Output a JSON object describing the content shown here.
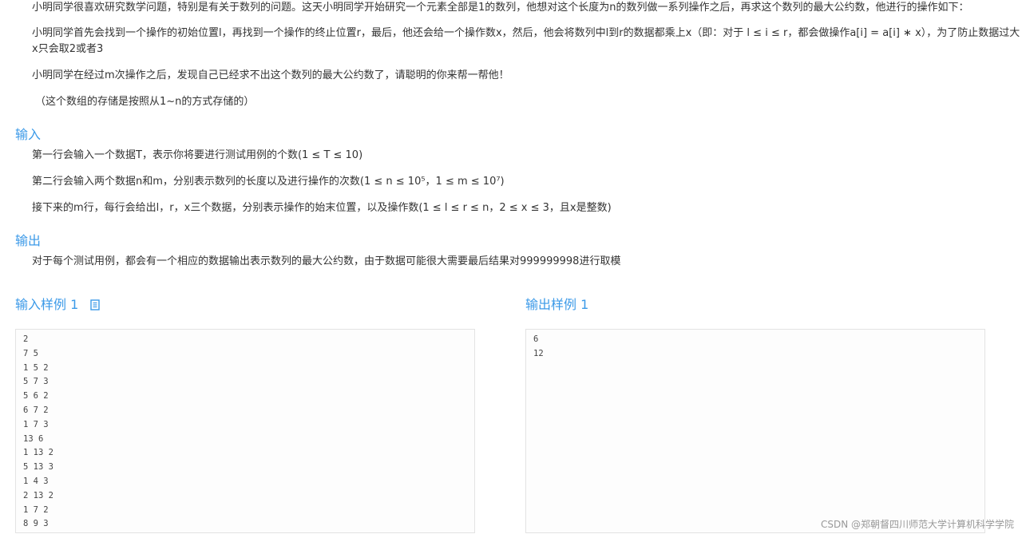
{
  "problem": {
    "p1": "小明同学很喜欢研究数学问题，特别是有关于数列的问题。这天小明同学开始研究一个元素全部是1的数列，他想对这个长度为n的数列做一系列操作之后，再求这个数列的最大公约数，他进行的操作如下：",
    "p2": "小明同学首先会找到一个操作的初始位置l，再找到一个操作的终止位置r，最后，他还会给一个操作数x，然后，他会将数列中l到r的数据都乘上x（即：对于 l ≤ i ≤ r，都会做操作a[i] = a[i] ∗ x），为了防止数据过大x只会取2或者3",
    "p3": "小明同学在经过m次操作之后，发现自己已经求不出这个数列的最大公约数了，请聪明的你来帮一帮他！",
    "p4": "（这个数组的存储是按照从1~n的方式存储的）"
  },
  "input_section": {
    "title": "输入",
    "line1": "第一行会输入一个数据T，表示你将要进行测试用例的个数(1 ≤ T ≤ 10)",
    "line2": "第二行会输入两个数据n和m，分别表示数列的长度以及进行操作的次数(1 ≤ n ≤ 10⁵，1 ≤ m ≤ 10⁷)",
    "line3": "接下来的m行，每行会给出l，r，x三个数据，分别表示操作的始末位置，以及操作数(1 ≤ l ≤ r ≤ n，2 ≤ x ≤ 3，且x是整数)"
  },
  "output_section": {
    "title": "输出",
    "line1": "对于每个测试用例，都会有一个相应的数据输出表示数列的最大公约数，由于数据可能很大需要最后结果对999999998进行取模"
  },
  "sample_input": {
    "title": "输入样例 1",
    "copy_icon": "copy-icon",
    "content": "2\n7 5\n1 5 2\n5 7 3\n5 6 2\n6 7 2\n1 7 3\n13 6\n1 13 2\n5 13 3\n1 4 3\n2 13 2\n1 7 2\n8 9 3"
  },
  "sample_output": {
    "title": "输出样例 1",
    "content": "6\n12"
  },
  "watermark": "CSDN @郑朝督四川师范大学计算机科学学院",
  "colors": {
    "heading": "#3c9ae8",
    "text": "#333333",
    "code_border": "#e3e3e3"
  }
}
